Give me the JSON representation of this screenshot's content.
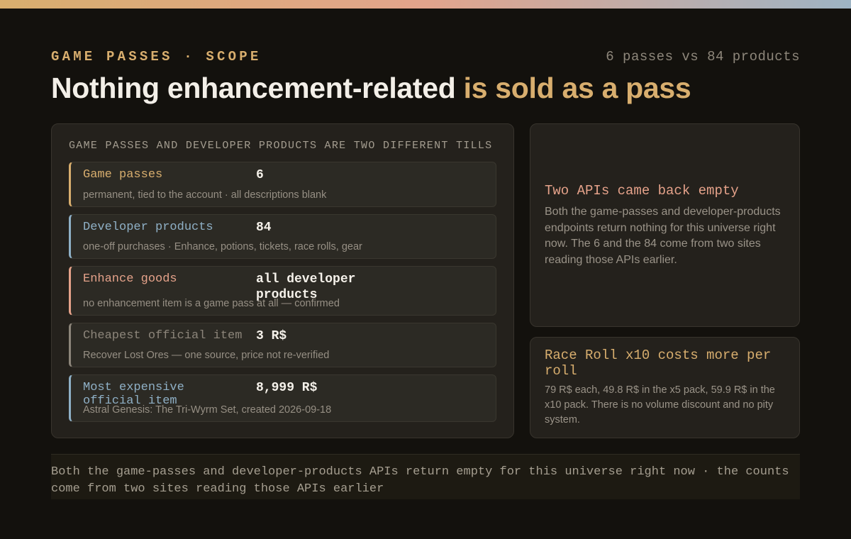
{
  "header": {
    "eyebrow": "GAME PASSES · SCOPE",
    "count_note": "6 passes vs 84 products",
    "headline_main": "Nothing enhancement-related ",
    "headline_accent": "is sold as a pass"
  },
  "main_panel": {
    "label": "GAME PASSES AND DEVELOPER PRODUCTS ARE TWO DIFFERENT TILLS",
    "rows": [
      {
        "name": "Game passes",
        "value": "6",
        "desc": "permanent, tied to the account · all descriptions blank",
        "accent": "#d8ae6e"
      },
      {
        "name": "Developer products",
        "value": "84",
        "desc": "one-off purchases · Enhance, potions, tickets, race rolls, gear",
        "accent": "#8fb0c6"
      },
      {
        "name": "Enhance goods",
        "value": "all developer products",
        "desc": "no enhancement item is a game pass at all — confirmed",
        "accent": "#e5a28a"
      },
      {
        "name": "Cheapest official item",
        "value": "3 R$",
        "desc": "Recover Lost Ores — one source, price not re-verified",
        "accent": "#8c857a"
      },
      {
        "name": "Most expensive official item",
        "value": "8,999 R$",
        "desc": "Astral Genesis: The Tri-Wyrm Set, created 2026-09-18",
        "accent": "#8fb0c6"
      }
    ]
  },
  "side_cards": [
    {
      "title": "Two APIs came back empty",
      "body": "Both the game-passes and developer-products endpoints return nothing for this universe right now. The 6 and the 84 come from two sites reading those APIs earlier.",
      "accent": "#e5a28a"
    },
    {
      "title": "Race Roll x10 costs more per roll",
      "body": "79 R$ each, 49.8 R$ in the x5 pack, 59.9 R$ in the x10 pack. There is no volume discount and no pity system.",
      "accent": "#d8ae6e"
    }
  ],
  "footer": {
    "text": "Both the game-passes and developer-products APIs return empty for this universe right now · the counts come from two sites reading those APIs earlier"
  }
}
